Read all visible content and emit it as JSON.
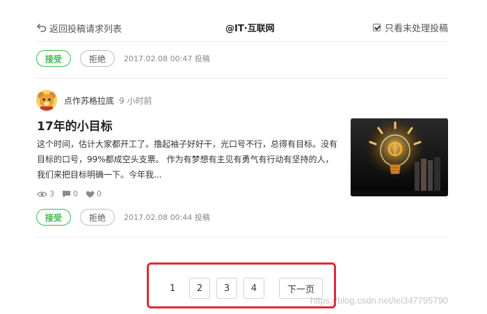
{
  "header": {
    "back_label": "返回投稿请求列表",
    "title": "@IT·互联网",
    "filter_label": "只看未处理投稿",
    "filter_checked": true
  },
  "first_actions": {
    "accept_label": "接受",
    "reject_label": "拒绝",
    "meta": "2017.02.08 00:47 投稿"
  },
  "article": {
    "author_name": "点作苏格拉底",
    "time_ago": "9 小时前",
    "title": "17年的小目标",
    "summary": "这个时间，估计大家都开工了。撸起袖子好好干，光口号不行，总得有目标。没有目标的口号，99%都成空头支票。 作为有梦想有主见有勇气有行动有坚持的人，我们来把目标明确一下。今年我...",
    "views": "3",
    "comments": "0",
    "likes": "0",
    "accept_label": "接受",
    "reject_label": "拒绝",
    "meta": "2017.02.08 00:44 投稿"
  },
  "pagination": {
    "pages": [
      "1",
      "2",
      "3",
      "4"
    ],
    "current": "1",
    "next_label": "下一页"
  },
  "watermark": "https://blog.csdn.net/lei347795790",
  "colors": {
    "accent_green": "#3eb84e",
    "highlight_red": "#e02b2b"
  }
}
